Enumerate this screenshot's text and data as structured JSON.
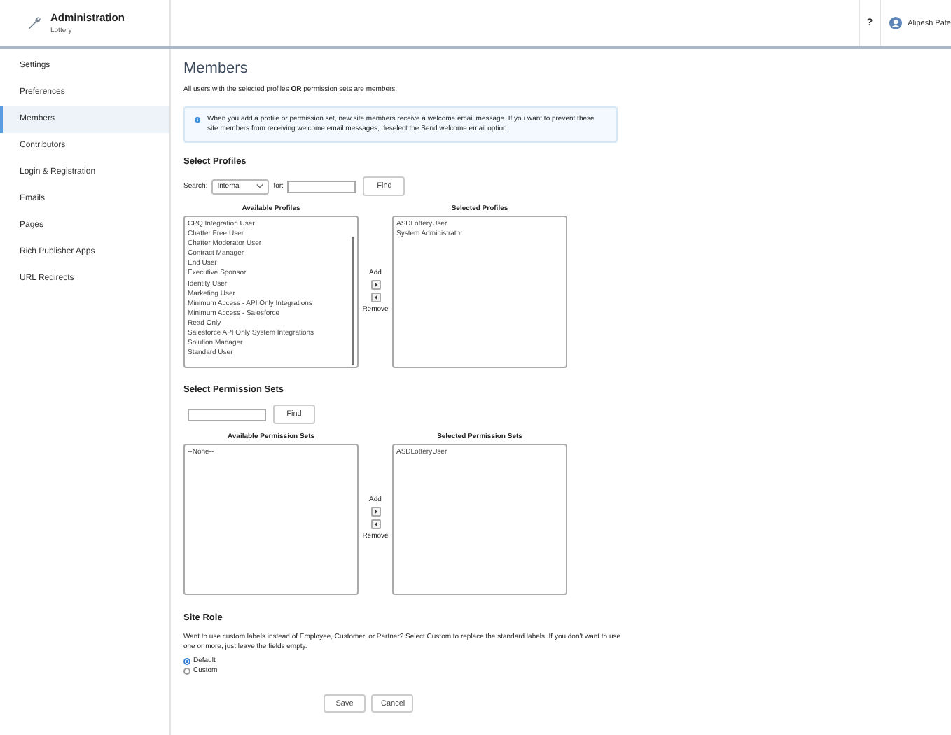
{
  "header": {
    "app_title": "Administration",
    "app_subtitle": "Lottery",
    "help": "?",
    "user_name": "Alipesh Pate"
  },
  "sidebar": {
    "items": [
      {
        "label": "Settings",
        "selected": false
      },
      {
        "label": "Preferences",
        "selected": false
      },
      {
        "label": "Members",
        "selected": true
      },
      {
        "label": "Contributors",
        "selected": false
      },
      {
        "label": "Login & Registration",
        "selected": false
      },
      {
        "label": "Emails",
        "selected": false
      },
      {
        "label": "Pages",
        "selected": false
      },
      {
        "label": "Rich Publisher Apps",
        "selected": false
      },
      {
        "label": "URL Redirects",
        "selected": false
      }
    ]
  },
  "page": {
    "title": "Members",
    "description": "All users with the selected profiles **OR** permission sets are members.",
    "info": "When you add a profile or permission set, new site members receive a welcome email message. If you want to prevent these site members from receiving welcome email messages, deselect the Send welcome email option."
  },
  "profiles": {
    "heading": "Select Profiles",
    "search_label": "Search:",
    "search_scope": "Internal",
    "for_label": "for:",
    "find": "Find",
    "available_title": "Available Profiles",
    "selected_title": "Selected Profiles",
    "add": "Add",
    "remove": "Remove",
    "available": [
      "CPQ Integration User",
      "Chatter Free User",
      "Chatter Moderator User",
      "Contract Manager",
      "End User",
      "Executive Sponsor",
      "Identity User",
      "Marketing User",
      "Minimum Access - API Only Integrations",
      "Minimum Access - Salesforce",
      "Read Only",
      "Salesforce API Only System Integrations",
      "Solution Manager",
      "Standard User"
    ],
    "selected": [
      "ASDLotteryUser",
      "System Administrator"
    ]
  },
  "permission_sets": {
    "heading": "Select Permission Sets",
    "find": "Find",
    "available_title": "Available Permission Sets",
    "selected_title": "Selected Permission Sets",
    "add": "Add",
    "remove": "Remove",
    "available": [
      "--None--"
    ],
    "selected": [
      "ASDLotteryUser"
    ]
  },
  "site_role": {
    "heading": "Site Role",
    "description": "Want to use custom labels instead of Employee, Customer, or Partner? Select Custom to replace the standard labels. If you don't want to use one or more, just leave the fields empty.",
    "options": [
      {
        "label": "Default",
        "selected": true
      },
      {
        "label": "Custom",
        "selected": false
      }
    ]
  },
  "buttons": [
    "Save",
    "Cancel"
  ]
}
